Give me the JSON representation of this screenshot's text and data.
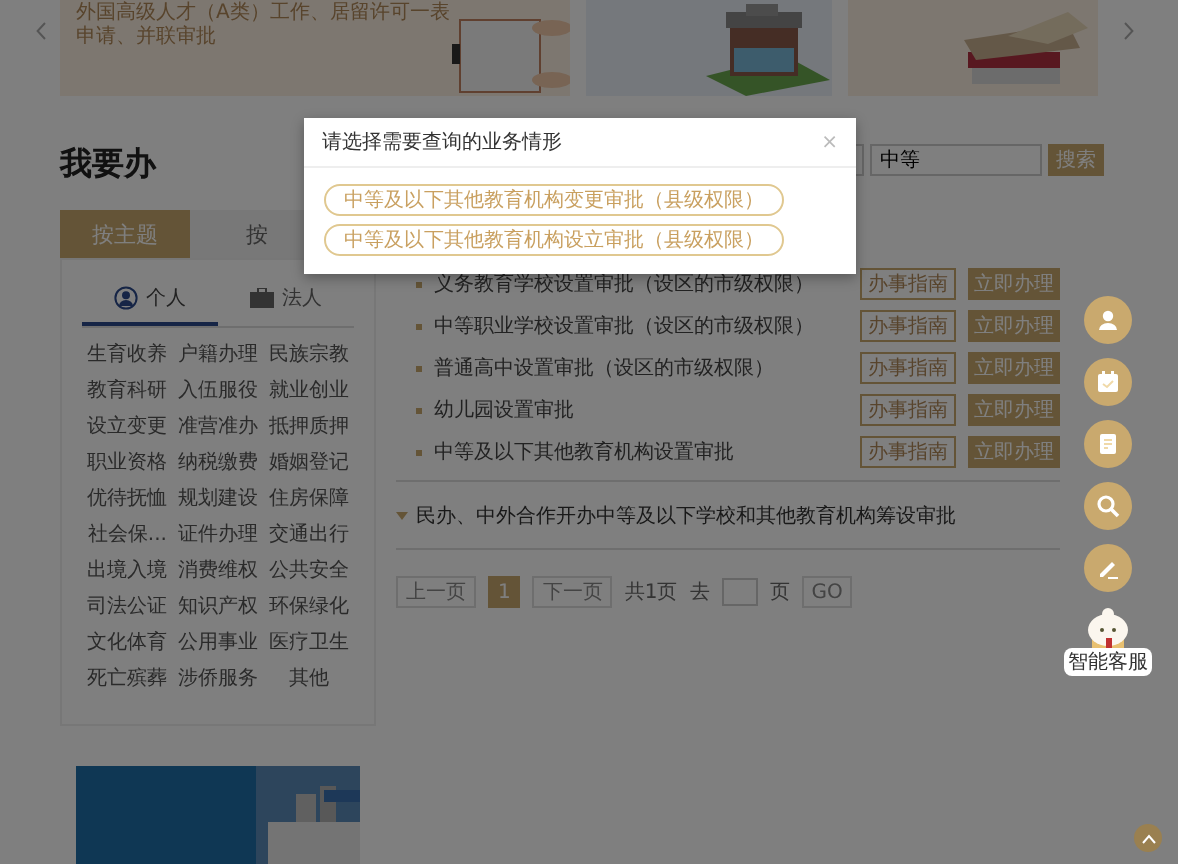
{
  "banner": {
    "caption": "外国高级人才（A类）工作、居留许可一表申请、并联审批"
  },
  "heading": "我要办",
  "main_tabs": [
    {
      "label": "按主题",
      "selected": true
    },
    {
      "label": "按",
      "selected": false
    }
  ],
  "sub_tabs": [
    {
      "label": "个人",
      "kind": "person",
      "selected": true
    },
    {
      "label": "法人",
      "kind": "briefcase",
      "selected": false
    }
  ],
  "categories": [
    "生育收养",
    "户籍办理",
    "民族宗教",
    "教育科研",
    "入伍服役",
    "就业创业",
    "设立变更",
    "准营准办",
    "抵押质押",
    "职业资格",
    "纳税缴费",
    "婚姻登记",
    "优待抚恤",
    "规划建设",
    "住房保障",
    "社会保...",
    "证件办理",
    "交通出行",
    "出境入境",
    "消费维权",
    "公共安全",
    "司法公证",
    "知识产权",
    "环保绿化",
    "文化体育",
    "公用事业",
    "医疗卫生",
    "死亡殡葬",
    "涉侨服务",
    "其他"
  ],
  "search": {
    "value": "中等",
    "button": "搜索"
  },
  "items": [
    {
      "title": "义务教育学校设置审批（设区的市级权限）",
      "guide": "办事指南",
      "apply": "立即办理"
    },
    {
      "title": "中等职业学校设置审批（设区的市级权限）",
      "guide": "办事指南",
      "apply": "立即办理"
    },
    {
      "title": "普通高中设置审批（设区的市级权限）",
      "guide": "办事指南",
      "apply": "立即办理"
    },
    {
      "title": "幼儿园设置审批",
      "guide": "办事指南",
      "apply": "立即办理"
    },
    {
      "title": "中等及以下其他教育机构设置审批",
      "guide": "办事指南",
      "apply": "立即办理"
    }
  ],
  "group": {
    "title": "民办、中外合作开办中等及以下学校和其他教育机构筹设审批",
    "expanded": false
  },
  "pagination": {
    "prev": "上一页",
    "pages": [
      {
        "label": "1",
        "selected": true
      }
    ],
    "next": "下一页",
    "total": "共1页",
    "goto": "去",
    "page_unit": "页",
    "go": "GO"
  },
  "float_tools": [
    {
      "kind": "person"
    },
    {
      "kind": "calendar"
    },
    {
      "kind": "note"
    },
    {
      "kind": "search"
    },
    {
      "kind": "pen"
    }
  ],
  "assistant": {
    "label": "智能客服"
  },
  "modal": {
    "title": "请选择需要查询的业务情形",
    "close": "×",
    "options": [
      "中等及以下其他教育机构变更审批（县级权限）",
      "中等及以下其他教育机构设立审批（县级权限）"
    ]
  }
}
